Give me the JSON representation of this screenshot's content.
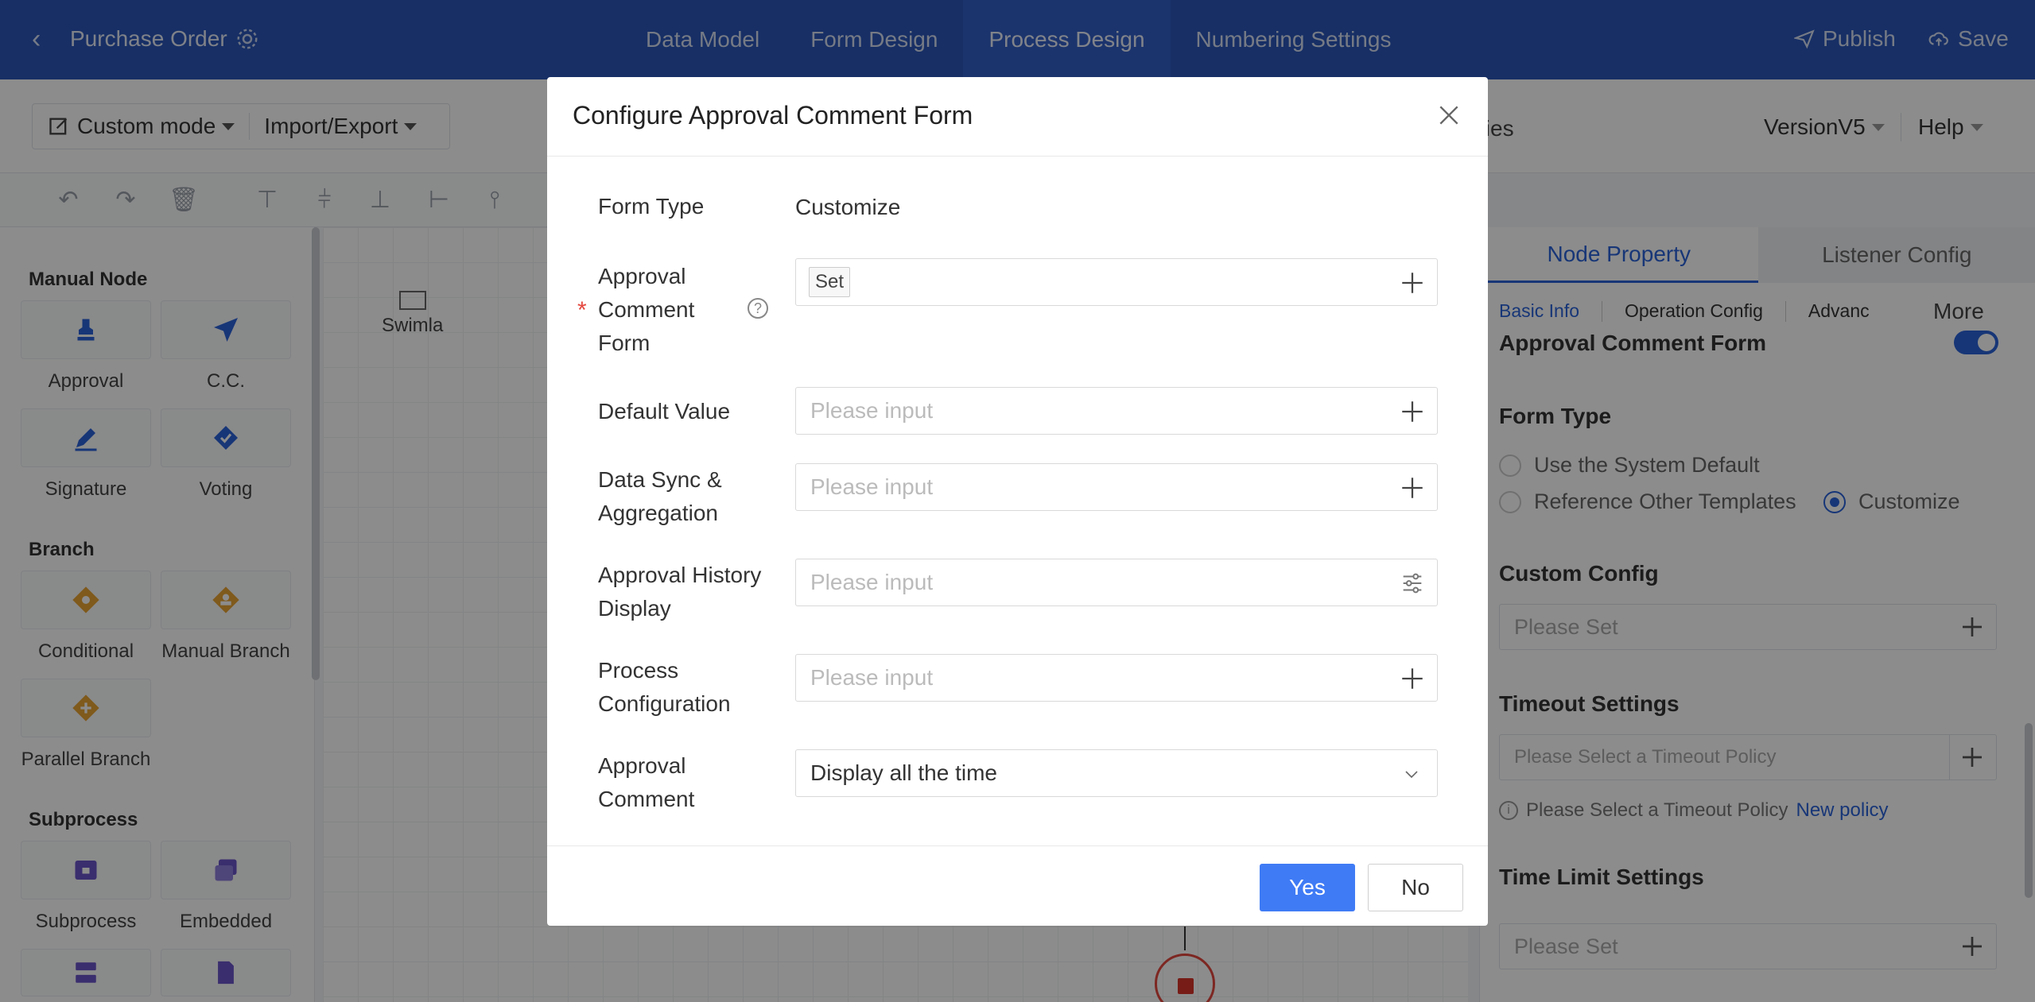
{
  "header": {
    "title": "Purchase Order",
    "tabs": [
      "Data Model",
      "Form Design",
      "Process Design",
      "Numbering Settings"
    ],
    "active_tab": "Process Design",
    "publish_label": "Publish",
    "save_label": "Save"
  },
  "toolbar": {
    "mode_label": "Custom mode",
    "import_export_label": "Import/Export",
    "truncated_tab": "ties",
    "version_label": "VersionV5",
    "help_label": "Help"
  },
  "palette": {
    "manual_node_heading": "Manual Node",
    "manual_nodes": [
      "Approval",
      "C.C.",
      "Signature",
      "Voting"
    ],
    "branch_heading": "Branch",
    "branch_nodes": [
      "Conditional",
      "Manual Branch",
      "Parallel Branch"
    ],
    "subprocess_heading": "Subprocess",
    "subprocess_nodes": [
      "Subprocess",
      "Embedded"
    ]
  },
  "canvas": {
    "swimlane_label": "Swimla"
  },
  "right_panel": {
    "tabs": [
      "Node Property",
      "Listener Config"
    ],
    "subtabs": [
      "Basic Info",
      "Operation Config",
      "Advanc"
    ],
    "more_label": "More",
    "approval_comment_form_title": "Approval Comment Form",
    "form_type_title": "Form Type",
    "form_type_options": [
      "Use the System Default",
      "Reference Other Templates",
      "Customize"
    ],
    "form_type_selected": "Customize",
    "custom_config_title": "Custom Config",
    "custom_config_placeholder": "Please Set",
    "timeout_title": "Timeout Settings",
    "timeout_placeholder": "Please Select a Timeout Policy",
    "timeout_hint": "Please Select a Timeout Policy",
    "new_policy_link": "New policy",
    "time_limit_title": "Time Limit Settings",
    "time_limit_placeholder": "Please Set"
  },
  "dialog": {
    "title": "Configure Approval Comment Form",
    "form_type_label": "Form Type",
    "form_type_value": "Customize",
    "approval_comment_form_label": "Approval Comment Form",
    "approval_comment_form_tag": "Set",
    "default_value_label": "Default Value",
    "data_sync_label": "Data Sync & Aggregation",
    "approval_history_label": "Approval History Display",
    "process_config_label": "Process Configuration",
    "approval_comment_label": "Approval Comment",
    "approval_comment_value": "Display all the time",
    "input_placeholder": "Please input",
    "yes_label": "Yes",
    "no_label": "No"
  },
  "colors": {
    "header_bg": "#2b56b9",
    "accent": "#3f7bf5",
    "required": "#e4483f"
  }
}
